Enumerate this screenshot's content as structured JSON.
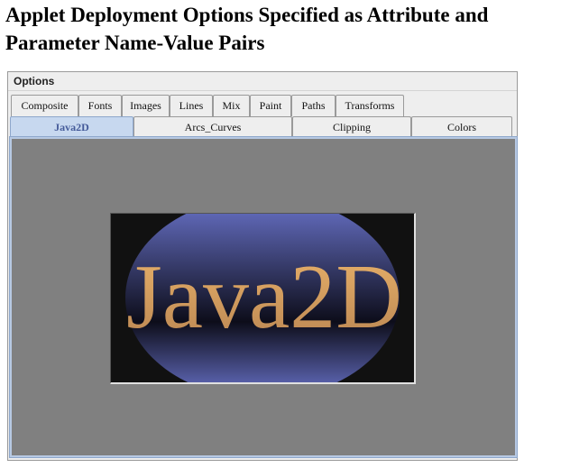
{
  "page": {
    "heading": "Applet Deployment Options Specified as Attribute and Parameter Name-Value Pairs"
  },
  "applet": {
    "title": "Options",
    "tabs_row1": [
      "Composite",
      "Fonts",
      "Images",
      "Lines",
      "Mix",
      "Paint",
      "Paths",
      "Transforms"
    ],
    "tabs_row2": [
      "Java2D",
      "Arcs_Curves",
      "Clipping",
      "Colors"
    ],
    "selected_tab": "Java2D",
    "demo_text": "Java2D",
    "colors": {
      "panel_bg": "#808080",
      "selected_tab_bg": "#c7d8ef",
      "selected_tab_text": "#445a99",
      "text_gradient_top": "#e9b26a",
      "text_gradient_bottom": "#b98552",
      "ellipse_gradient_top": "#6a74cc",
      "ellipse_gradient_middle": "#0d0d1a"
    }
  }
}
